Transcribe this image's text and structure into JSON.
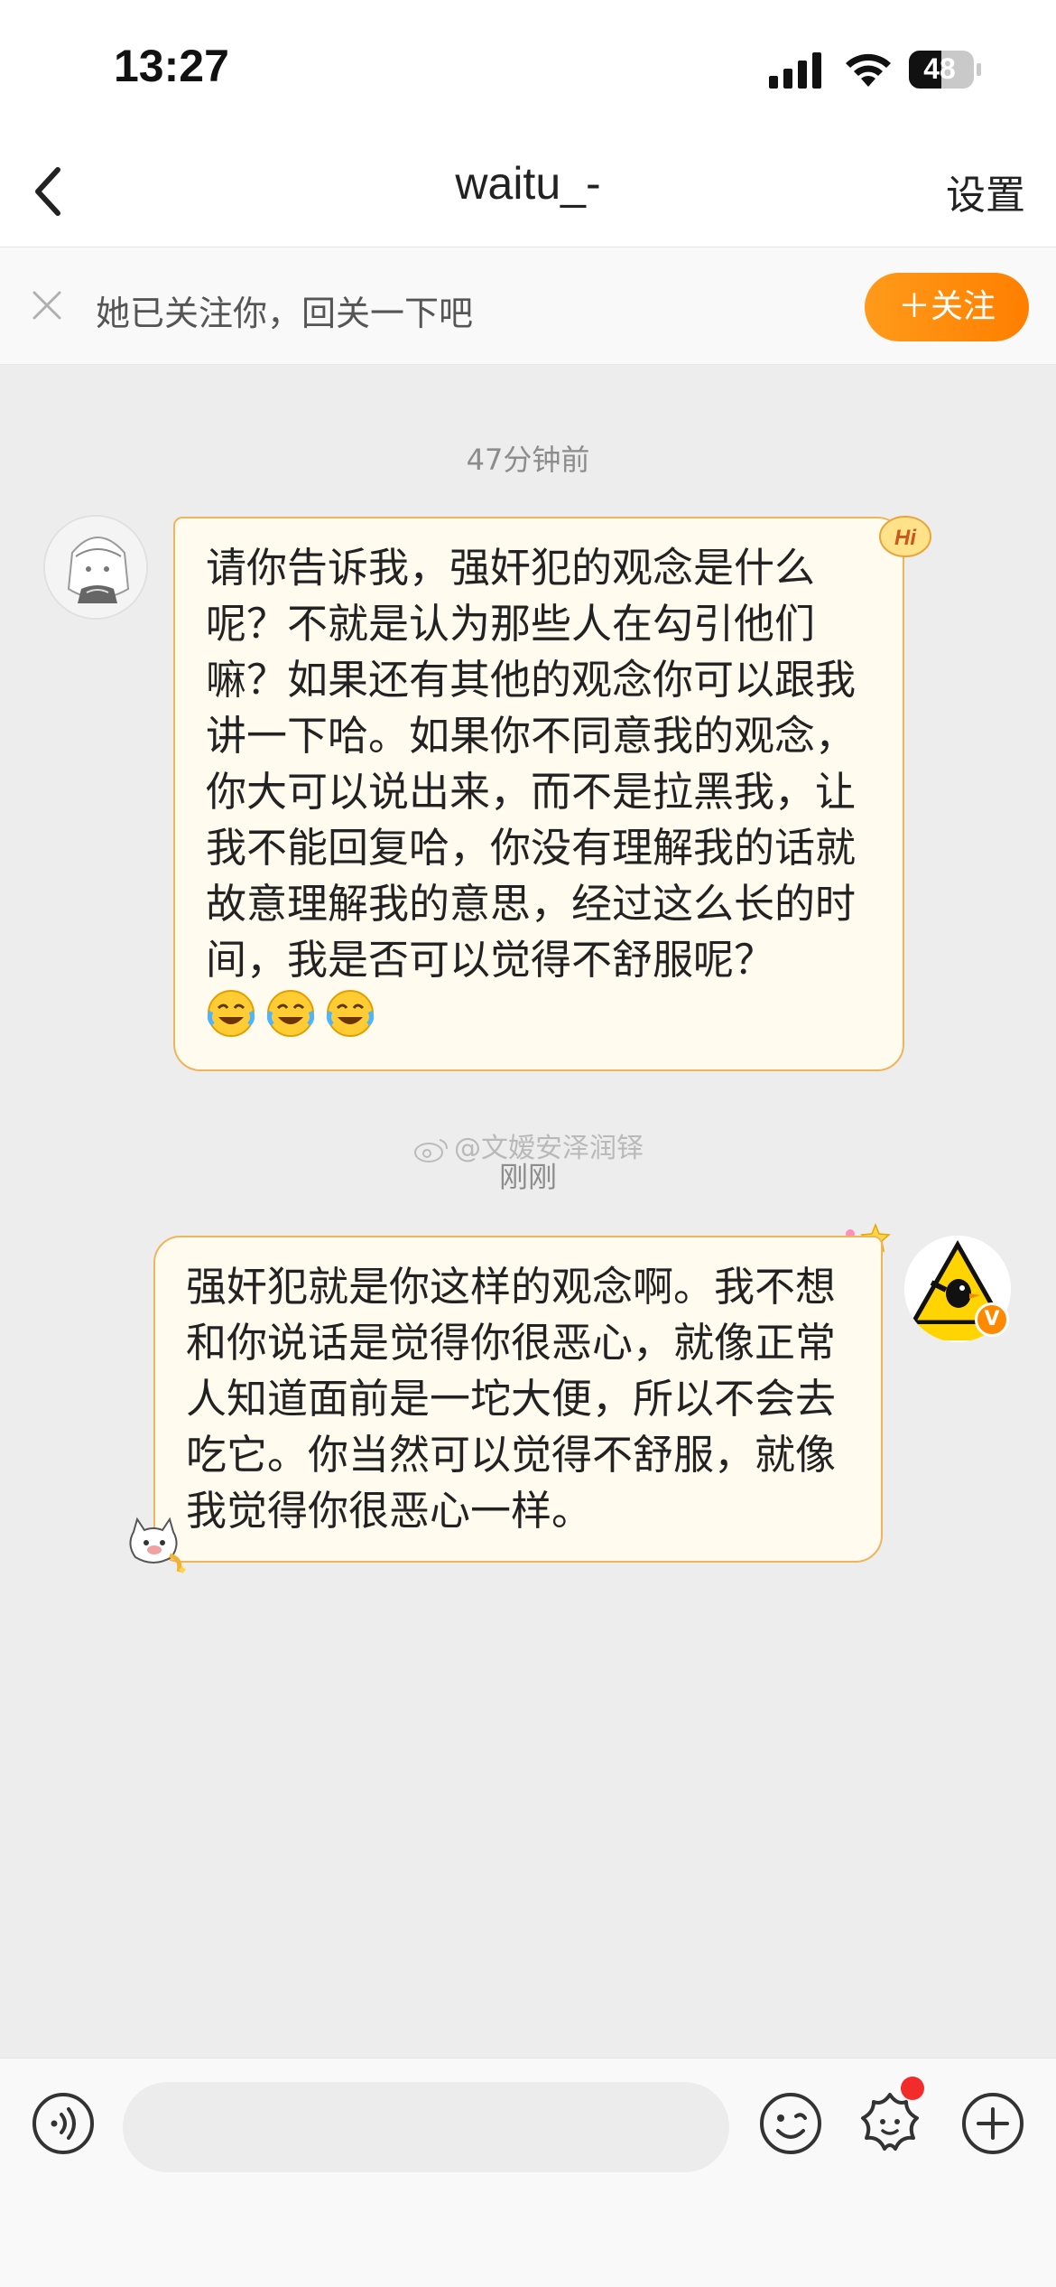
{
  "status_bar": {
    "time": "13:27",
    "battery": "48"
  },
  "nav": {
    "title": "waitu_-",
    "settings_label": "设置"
  },
  "follow_banner": {
    "text": "她已关注你，回关一下吧",
    "follow_button_label": "＋关注"
  },
  "conversation": {
    "timestamp_1": "47分钟前",
    "message_1": {
      "sender": "other",
      "text": "请你告诉我，强奸犯的观念是什么呢？不就是认为那些人在勾引他们嘛？如果还有其他的观念你可以跟我讲一下哈。如果你不同意我的观念，你大可以说出来，而不是拉黑我，让我不能回复哈，你没有理解我的话就故意理解我的意思，经过这么长的时间，我是否可以觉得不舒服呢？",
      "emojis": [
        "laugh-cry",
        "laugh-cry",
        "laugh-cry"
      ],
      "sticker": "Hi"
    },
    "watermark": "@文嫒安泽润铎",
    "timestamp_2": "刚刚",
    "message_2": {
      "sender": "me",
      "text": "强奸犯就是你这样的观念啊。我不想和你说话是觉得你很恶心，就像正常人知道面前是一坨大便，所以不会去吃它。你当然可以觉得不舒服，就像我觉得你很恶心一样。",
      "avatar_caption": "当心鸡械",
      "verified_badge": "V"
    }
  },
  "input_bar": {
    "placeholder": ""
  },
  "colors": {
    "accent_orange": "#ff8a00",
    "bubble_bg": "#fffbee",
    "bubble_border": "#f0b45a",
    "notification_red": "#f22b2b"
  }
}
